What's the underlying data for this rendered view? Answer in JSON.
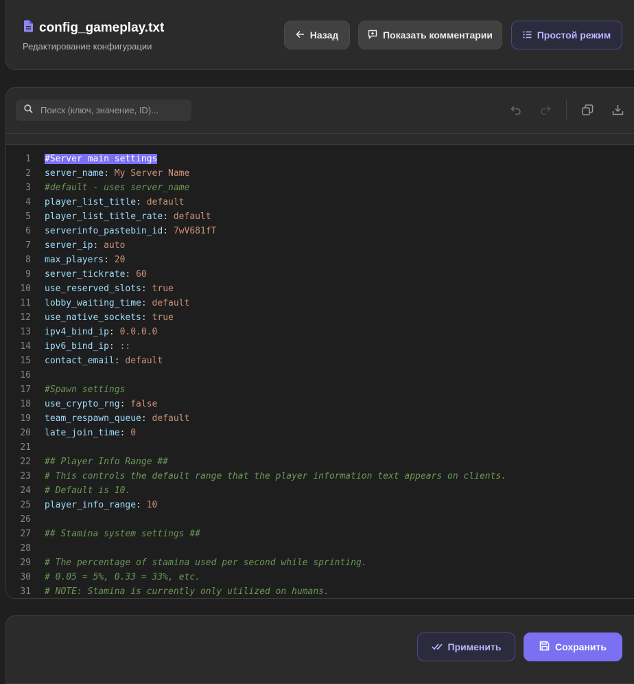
{
  "header": {
    "file_name": "config_gameplay.txt",
    "subtitle": "Редактирование конфигурации",
    "back_label": "Назад",
    "comments_label": "Показать комментарии",
    "simple_mode_label": "Простой режим"
  },
  "toolbar": {
    "search_placeholder": "Поиск (ключ, значение, ID)...",
    "icons": [
      "undo-icon",
      "redo-icon",
      "copy-icon",
      "download-icon"
    ]
  },
  "editor": {
    "selected_line": 1,
    "lines": [
      {
        "n": "1",
        "type": "comment-sel",
        "text": "#Server main settings"
      },
      {
        "n": "2",
        "type": "kv",
        "key": "server_name",
        "value": "My Server Name"
      },
      {
        "n": "3",
        "type": "comment",
        "text": "#default - uses server_name"
      },
      {
        "n": "4",
        "type": "kv",
        "key": "player_list_title",
        "value": "default"
      },
      {
        "n": "5",
        "type": "kv",
        "key": "player_list_title_rate",
        "value": "default"
      },
      {
        "n": "6",
        "type": "kv",
        "key": "serverinfo_pastebin_id",
        "value": "7wV681fT"
      },
      {
        "n": "7",
        "type": "kv",
        "key": "server_ip",
        "value": "auto"
      },
      {
        "n": "8",
        "type": "kv",
        "key": "max_players",
        "value": "20"
      },
      {
        "n": "9",
        "type": "kv",
        "key": "server_tickrate",
        "value": "60"
      },
      {
        "n": "10",
        "type": "kv",
        "key": "use_reserved_slots",
        "value": "true"
      },
      {
        "n": "11",
        "type": "kv",
        "key": "lobby_waiting_time",
        "value": "default"
      },
      {
        "n": "12",
        "type": "kv",
        "key": "use_native_sockets",
        "value": "true"
      },
      {
        "n": "13",
        "type": "kv",
        "key": "ipv4_bind_ip",
        "value": "0.0.0.0"
      },
      {
        "n": "14",
        "type": "kv",
        "key": "ipv6_bind_ip",
        "value": "::"
      },
      {
        "n": "15",
        "type": "kv",
        "key": "contact_email",
        "value": "default"
      },
      {
        "n": "16",
        "type": "empty"
      },
      {
        "n": "17",
        "type": "comment",
        "text": "#Spawn settings"
      },
      {
        "n": "18",
        "type": "kv",
        "key": "use_crypto_rng",
        "value": "false"
      },
      {
        "n": "19",
        "type": "kv",
        "key": "team_respawn_queue",
        "value": "default"
      },
      {
        "n": "20",
        "type": "kv",
        "key": "late_join_time",
        "value": "0"
      },
      {
        "n": "21",
        "type": "empty"
      },
      {
        "n": "22",
        "type": "comment",
        "text": "## Player Info Range ##"
      },
      {
        "n": "23",
        "type": "comment",
        "text": "# This controls the default range that the player information text appears on clients."
      },
      {
        "n": "24",
        "type": "comment",
        "text": "# Default is 10."
      },
      {
        "n": "25",
        "type": "kv",
        "key": "player_info_range",
        "value": "10"
      },
      {
        "n": "26",
        "type": "empty"
      },
      {
        "n": "27",
        "type": "comment",
        "text": "## Stamina system settings ##"
      },
      {
        "n": "28",
        "type": "empty"
      },
      {
        "n": "29",
        "type": "comment",
        "text": "# The percentage of stamina used per second while sprinting."
      },
      {
        "n": "30",
        "type": "comment",
        "text": "# 0.05 = 5%, 0.33 = 33%, etc."
      },
      {
        "n": "31",
        "type": "comment",
        "text": "# NOTE: Stamina is currently only utilized on humans."
      }
    ]
  },
  "footer": {
    "apply_label": "Применить",
    "save_label": "Сохранить"
  },
  "colors": {
    "accent": "#7b6ff2",
    "key": "#9cdcfe",
    "value": "#ce9178",
    "comment": "#6a9955"
  }
}
